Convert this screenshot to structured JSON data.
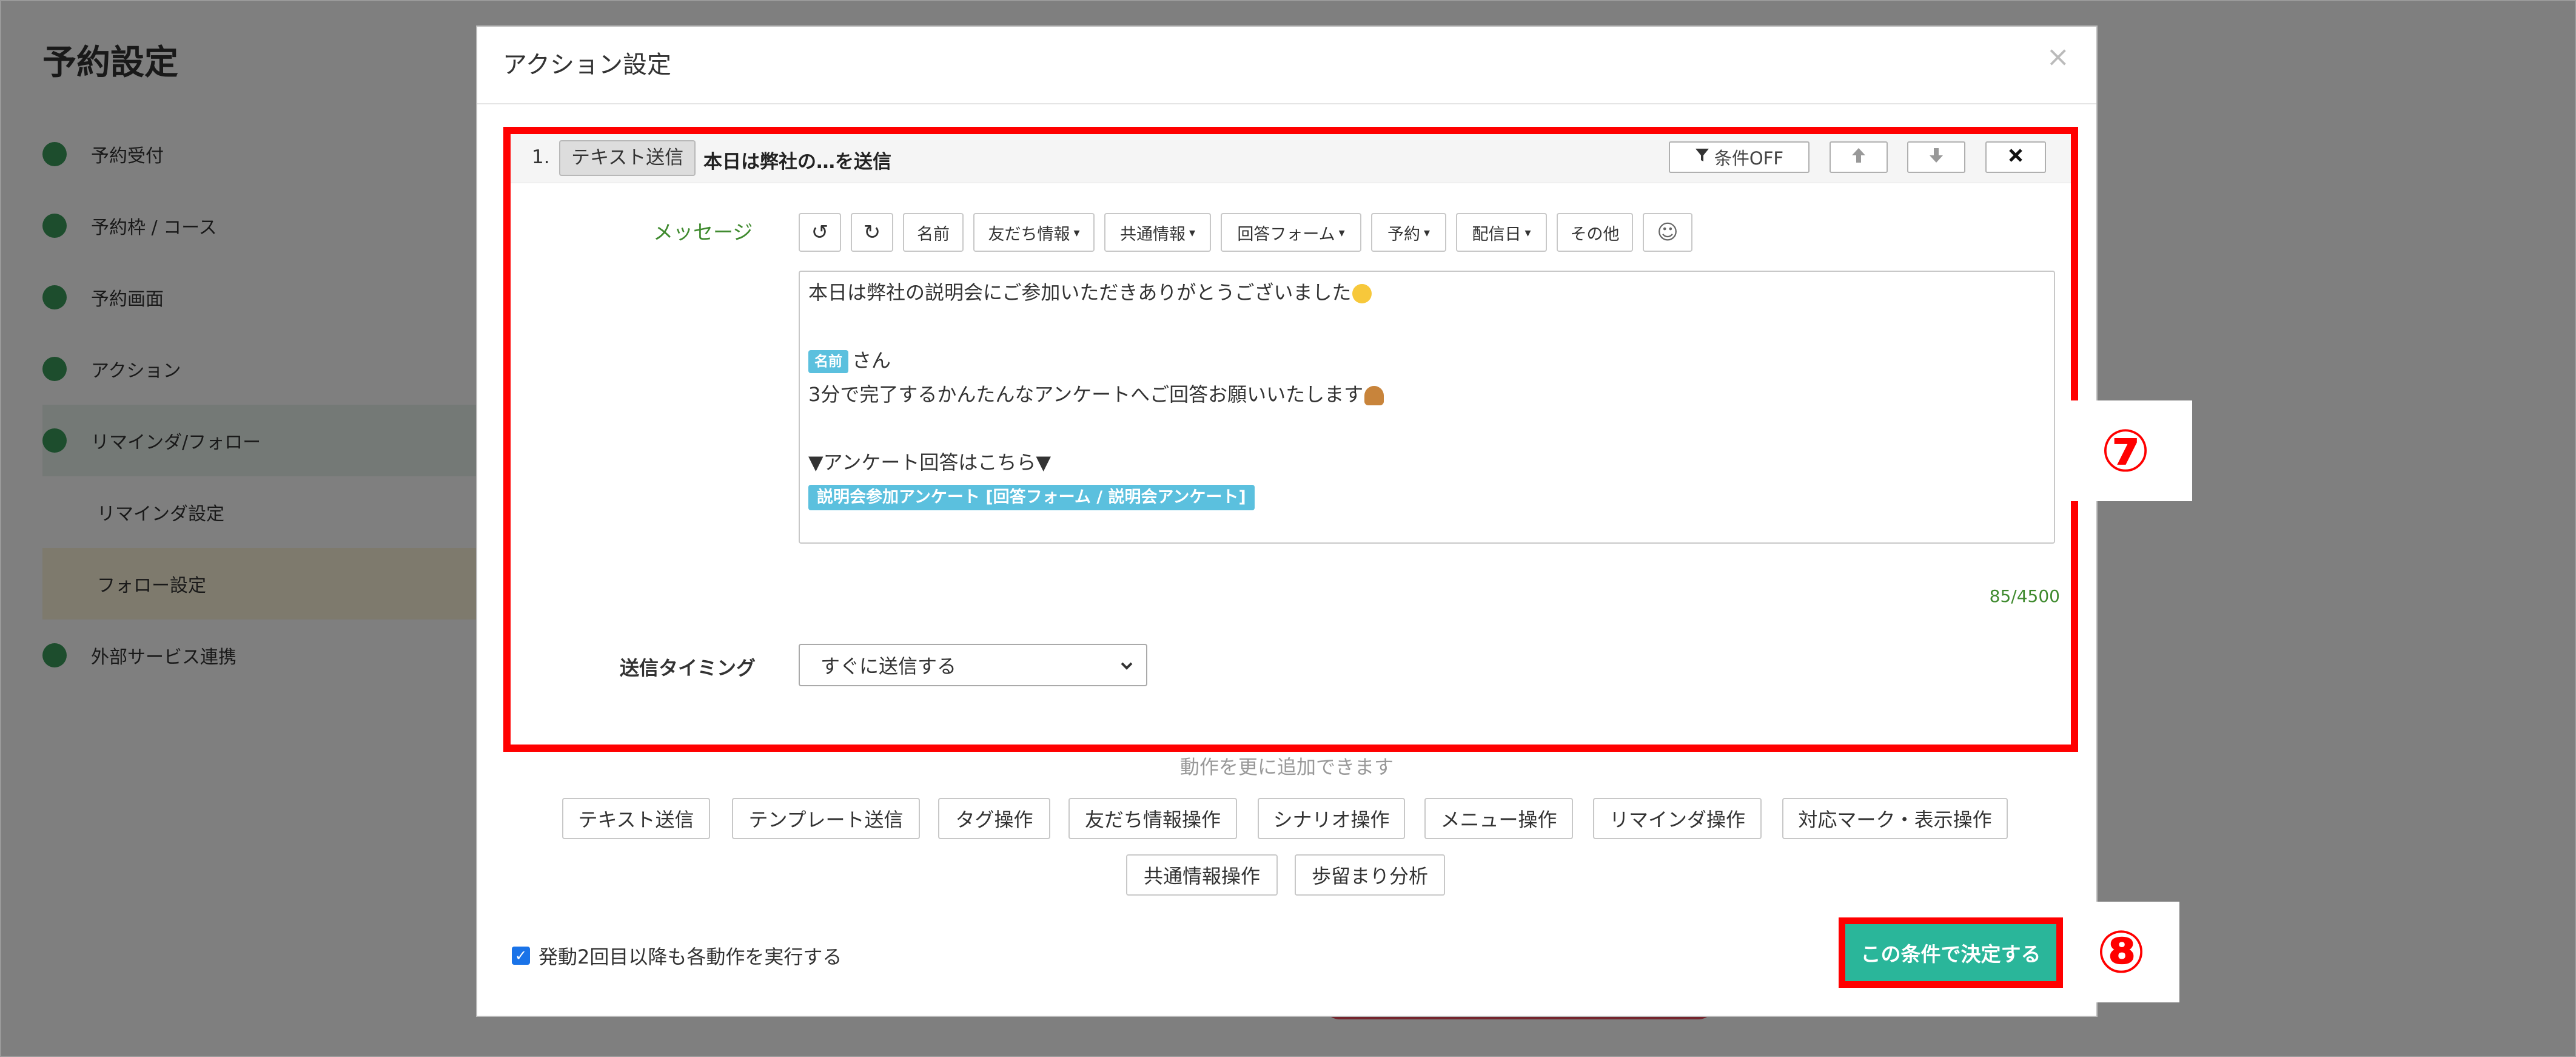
{
  "background": {
    "page_title": "予約設定",
    "nav_items": [
      "予約受付",
      "予約枠 / コース",
      "予約画面",
      "アクション",
      "リマインダ/フォロー"
    ],
    "sub_items": [
      "リマインダ設定",
      "フォロー設定"
    ],
    "nav_last": "外部サービス連携"
  },
  "modal": {
    "title": "アクション設定",
    "close_icon": "×"
  },
  "action": {
    "number": "1.",
    "type_label": "テキスト送信",
    "summary": "本日は弊社の…を送信",
    "condition_button": "条件OFF",
    "up_icon": "arrow-up-icon",
    "down_icon": "arrow-down-icon",
    "delete_icon": "close-icon"
  },
  "message": {
    "label": "メッセージ",
    "toolbar": {
      "undo": "↺",
      "redo": "↻",
      "name": "名前",
      "friend_info": "友だち情報",
      "shared_info": "共通情報",
      "answer_form": "回答フォーム",
      "reservation": "予約",
      "delivery_date": "配信日",
      "other": "その他",
      "emoji": "☺"
    },
    "lines": {
      "l1": "本日は弊社の説明会にご参加いただきありがとうございました",
      "name_tag": "名前",
      "l3_suffix": "さん",
      "l4": "3分で完了するかんたんなアンケートへご回答お願いいたします",
      "l6": "▼アンケート回答はこちら▼",
      "form_tag": "説明会参加アンケート [回答フォーム / 説明会アンケート]"
    },
    "counter": "85/4500"
  },
  "timing": {
    "label": "送信タイミング",
    "value": "すぐに送信する"
  },
  "add_actions": {
    "hint": "動作を更に追加できます",
    "row1": [
      "テキスト送信",
      "テンプレート送信",
      "タグ操作",
      "友だち情報操作",
      "シナリオ操作",
      "メニュー操作",
      "リマインダ操作",
      "対応マーク・表示操作"
    ],
    "row2": [
      "共通情報操作",
      "歩留まり分析"
    ]
  },
  "footer": {
    "repeat_label": "発動2回目以降も各動作を実行する",
    "repeat_checked": true,
    "submit": "この条件で決定する"
  },
  "markers": {
    "seven": "⑦",
    "eight": "⑧"
  },
  "colors": {
    "accent_green": "#2ab69a",
    "highlight_red": "#ff0000",
    "tag_blue": "#5bc0de"
  }
}
